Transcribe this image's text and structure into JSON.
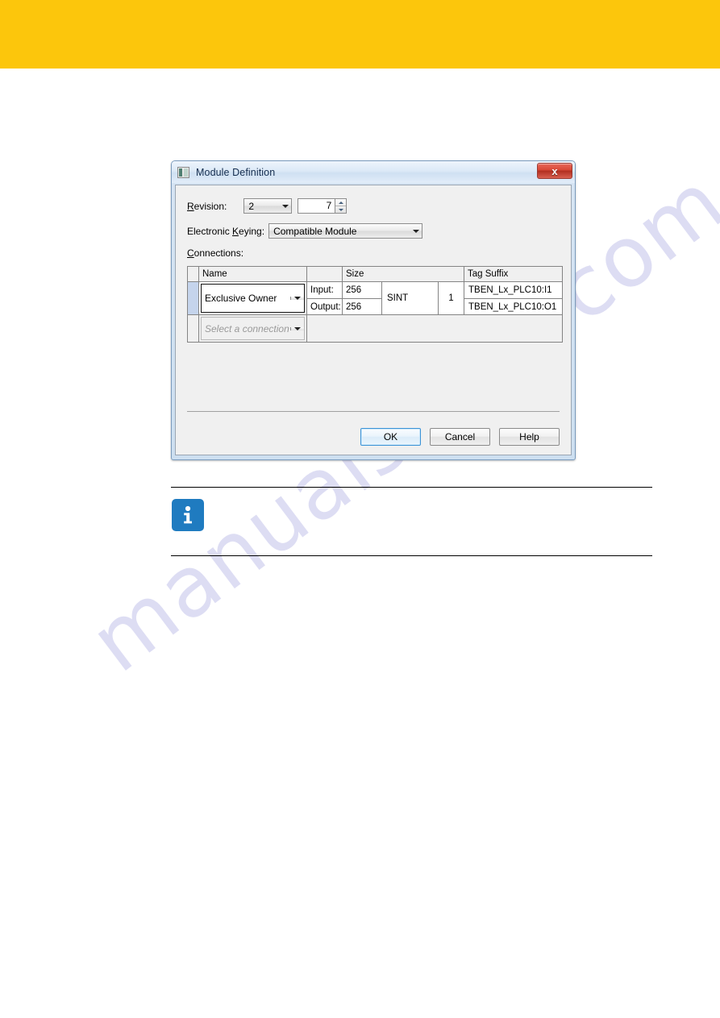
{
  "page": {
    "header_band_color": "#fcc60c",
    "watermark_text": "manualshive.com",
    "watermark_color": "#d8d8f2"
  },
  "dialog": {
    "title": "Module Definition",
    "title_icon": "module-icon",
    "close_label": "x",
    "fields": {
      "revision": {
        "label": "Revision:",
        "major_value": "2",
        "minor_value": "7"
      },
      "electronic_keying": {
        "label": "Electronic Keying:",
        "value": "Compatible Module"
      },
      "connections": {
        "label": "Connections:"
      }
    },
    "grid": {
      "headers": {
        "select": "",
        "name": "Name",
        "io": "",
        "size": "Size",
        "tag_suffix": "Tag Suffix"
      },
      "rows": [
        {
          "selected": true,
          "name": "Exclusive Owner",
          "input_label": "Input:",
          "input_size": "256",
          "output_label": "Output:",
          "output_size": "256",
          "data_type": "SINT",
          "count": "1",
          "tag_input": "TBEN_Lx_PLC10:I1",
          "tag_output": "TBEN_Lx_PLC10:O1"
        },
        {
          "selected": false,
          "placeholder": "Select a connection"
        }
      ]
    },
    "buttons": {
      "ok": "OK",
      "cancel": "Cancel",
      "help": "Help"
    }
  },
  "note": {
    "icon": "info-icon",
    "text": ""
  }
}
